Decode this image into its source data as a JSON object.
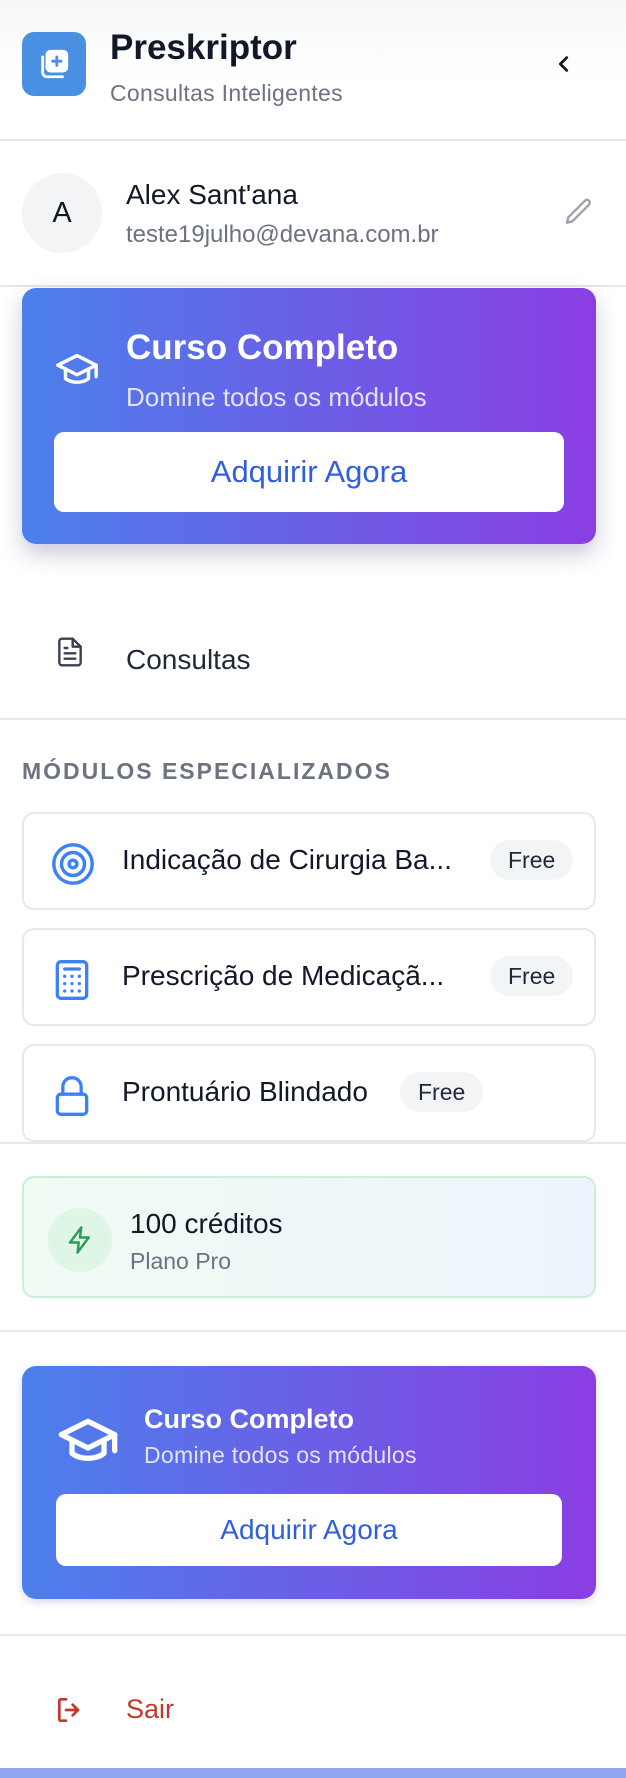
{
  "app": {
    "title": "Preskriptor",
    "subtitle": "Consultas Inteligentes"
  },
  "user": {
    "initial": "A",
    "name": "Alex Sant'ana",
    "email": "teste19julho@devana.com.br"
  },
  "promo_top": {
    "title": "Curso Completo",
    "subtitle": "Domine todos os módulos",
    "button": "Adquirir Agora"
  },
  "nav": {
    "consultas_label": "Consultas"
  },
  "modules": {
    "section_title": "MÓDULOS ESPECIALIZADOS",
    "items": [
      {
        "label": "Indicação de Cirurgia Ba...",
        "badge": "Free",
        "icon": "target-icon"
      },
      {
        "label": "Prescrição de Medicaçã...",
        "badge": "Free",
        "icon": "calculator-icon"
      },
      {
        "label": "Prontuário Blindado",
        "badge": "Free",
        "icon": "lock-icon"
      }
    ]
  },
  "credits": {
    "amount": "100 créditos",
    "plan": "Plano Pro"
  },
  "promo_bottom": {
    "title": "Curso Completo",
    "subtitle": "Domine todos os módulos",
    "button": "Adquirir Agora"
  },
  "logout": {
    "label": "Sair"
  },
  "colors": {
    "brand_blue": "#4a90e2",
    "gradient_start": "#4c80ec",
    "gradient_end": "#8a3ee2",
    "button_text": "#2f5fe0",
    "logout_red": "#c0392b",
    "credits_green": "#2e9e55"
  }
}
